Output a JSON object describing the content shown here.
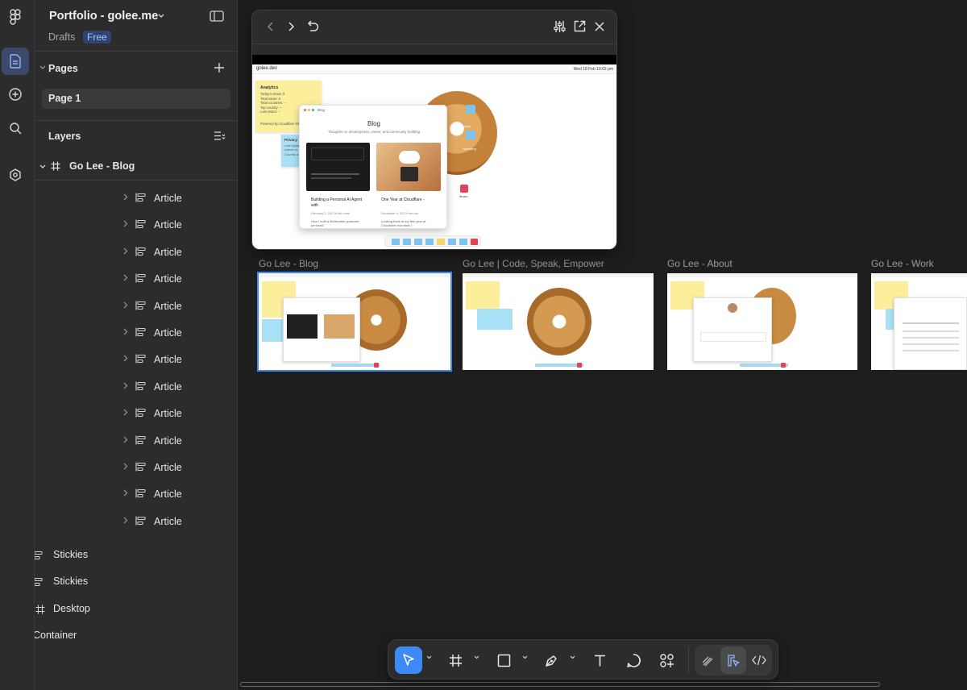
{
  "file": {
    "title": "Portfolio - golee.me",
    "location": "Drafts",
    "plan_badge": "Free"
  },
  "pages": {
    "header": "Pages",
    "items": [
      {
        "label": "Page 1"
      }
    ]
  },
  "layers": {
    "header": "Layers",
    "root": "Go Lee - Blog",
    "articles": [
      "Article",
      "Article",
      "Article",
      "Article",
      "Article",
      "Article",
      "Article",
      "Article",
      "Article",
      "Article",
      "Article",
      "Article",
      "Article"
    ],
    "siblings": [
      {
        "label": "Stickies",
        "icon": "auto-layout-icon"
      },
      {
        "label": "Stickies",
        "icon": "auto-layout-icon"
      },
      {
        "label": "Desktop",
        "icon": "frame-icon"
      },
      {
        "label": "Container",
        "icon": "none"
      }
    ]
  },
  "canvas": {
    "frames": [
      {
        "title": "Go Lee - Blog",
        "selected": true
      },
      {
        "title": "Go Lee | Code, Speak, Empower"
      },
      {
        "title": "Go Lee - About"
      },
      {
        "title": "Go Lee - Work"
      }
    ]
  },
  "preview": {
    "site_name": "golee.dev",
    "date": "Wed 18 Feb 10:02 pm",
    "analytics": {
      "title": "Analytics",
      "lines": [
        "Today's views: 0",
        "Total views: 0",
        "Total countries: --",
        "Top country: --",
        "Last visitor: --"
      ],
      "footer": "Powered by Cloudflare D1"
    },
    "privacy": {
      "title": "Privacy",
      "lines": [
        "Last Updat",
        "collect m",
        "Country a"
      ]
    },
    "blog": {
      "window_label": "Blog",
      "title": "Blog",
      "subtitle": "Thoughts on development, career, and community building",
      "posts": [
        {
          "title": "Building a Personal AI Agent with",
          "meta": "February 2, 202  16 min read",
          "excerpt": "How I built a Moltworker-powered personal"
        },
        {
          "title": "One Year at Cloudflare -",
          "meta": "December 4, 202  8 min rea",
          "excerpt": "Looking back at my first year at Cloudflare and what I"
        }
      ]
    },
    "bagel_labels": {
      "community": "Community",
      "speaking": "Speaking",
      "music": "Music"
    }
  },
  "toolbar": {
    "tools": [
      "move-icon",
      "frame-icon",
      "rectangle-icon",
      "pen-icon",
      "text-icon",
      "comment-icon",
      "actions-icon"
    ],
    "modes": [
      "draw-icon",
      "design-icon",
      "dev-mode-icon"
    ]
  },
  "colors": {
    "accent": "#3d8af7",
    "canvas": "#1e1e1e",
    "panel": "#2c2c2c",
    "sticky_yellow": "#fcef9c",
    "sticky_blue": "#a8e0f5"
  }
}
